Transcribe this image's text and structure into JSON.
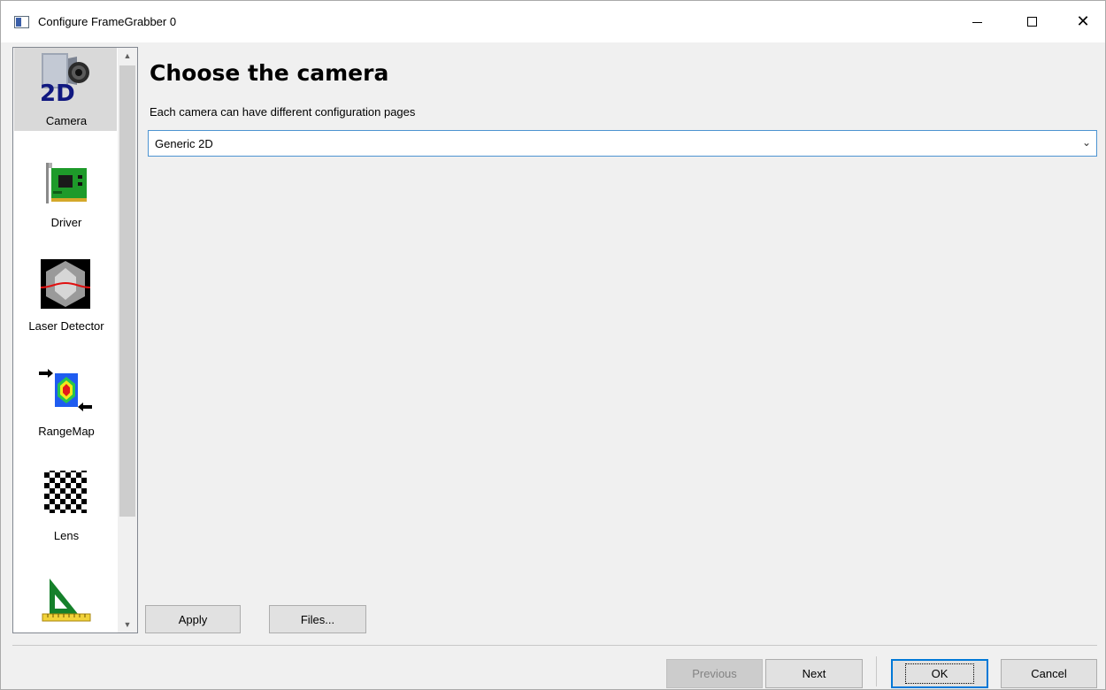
{
  "window": {
    "title": "Configure FrameGrabber 0",
    "minimize_glyph": "—",
    "maximize_glyph": "☐",
    "close_glyph": "✕"
  },
  "sidebar": {
    "items": [
      {
        "label": "Camera",
        "icon": "camera-2d-icon",
        "selected": true
      },
      {
        "label": "Driver",
        "icon": "driver-card-icon"
      },
      {
        "label": "Laser Detector",
        "icon": "laser-detector-icon"
      },
      {
        "label": "RangeMap",
        "icon": "rangemap-icon"
      },
      {
        "label": "Lens",
        "icon": "lens-checkerboard-icon"
      },
      {
        "label": "",
        "icon": "calibration-ruler-icon"
      }
    ],
    "scroll_up_glyph": "▲",
    "scroll_down_glyph": "▼"
  },
  "main": {
    "heading": "Choose the camera",
    "subtitle": "Each camera can have different configuration pages",
    "camera_select": {
      "value": "Generic 2D",
      "chevron": "⌄"
    },
    "apply_label": "Apply",
    "files_label": "Files..."
  },
  "footer": {
    "previous_label": "Previous",
    "next_label": "Next",
    "ok_label": "OK",
    "cancel_label": "Cancel"
  },
  "colors": {
    "accent": "#0078d7",
    "selected_item": "#d9d9d9",
    "window_bg": "#f0f0f0"
  }
}
